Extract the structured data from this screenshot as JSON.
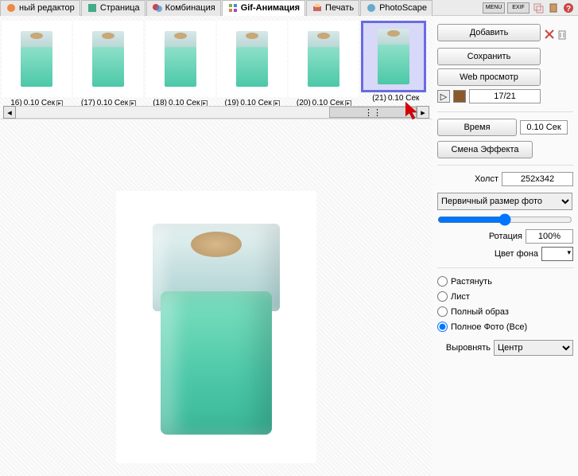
{
  "tabs": [
    {
      "label": "ный редактор",
      "icon": "editor"
    },
    {
      "label": "Страница",
      "icon": "page"
    },
    {
      "label": "Комбинация",
      "icon": "combo"
    },
    {
      "label": "Gif-Анимация",
      "icon": "gif",
      "active": true
    },
    {
      "label": "Печать",
      "icon": "print"
    },
    {
      "label": "PhotoScape",
      "icon": "app"
    }
  ],
  "toolbar_right": {
    "menu": "MENU",
    "exif": "EXIF"
  },
  "thumbnails": [
    {
      "num": "16)",
      "time": "0.10 Сек"
    },
    {
      "num": "(17)",
      "time": "0.10 Сек"
    },
    {
      "num": "(18)",
      "time": "0.10 Сек"
    },
    {
      "num": "(19)",
      "time": "0.10 Сек"
    },
    {
      "num": "(20)",
      "time": "0.10 Сек"
    },
    {
      "num": "(21)",
      "time": "0.10 Сек",
      "selected": true
    }
  ],
  "sidebar": {
    "add": "Добавить",
    "save": "Сохранить",
    "web": "Web просмотр",
    "counter": "17/21",
    "time_btn": "Время",
    "time_val": "0.10 Сек",
    "effect": "Смена Эффекта",
    "canvas_label": "Холст",
    "canvas_val": "252x342",
    "size_mode": "Первичный размер фото",
    "rotation_label": "Ротация",
    "rotation_val": "100%",
    "bg_label": "Цвет фона",
    "fit": {
      "stretch": "Растянуть",
      "sheet": "Лист",
      "full_image": "Полный образ",
      "full_photo": "Полное Фото (Все)"
    },
    "align_label": "Выровнять",
    "align_val": "Центр"
  }
}
